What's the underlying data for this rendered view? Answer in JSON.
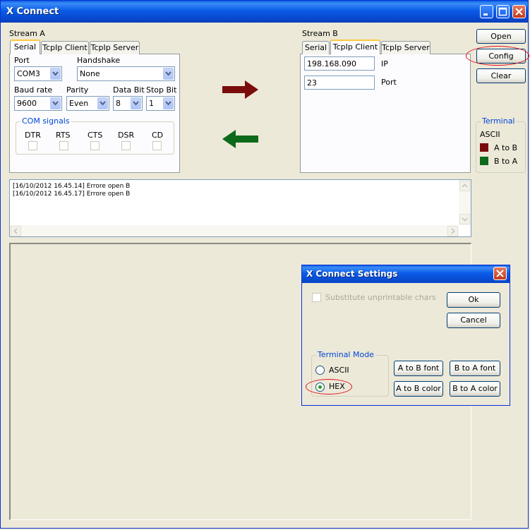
{
  "window": {
    "title": "X Connect"
  },
  "stream_a": {
    "label": "Stream A",
    "tabs": [
      "Serial",
      "TcpIp Client",
      "TcpIp Server"
    ],
    "port_label": "Port",
    "port_value": "COM3",
    "handshake_label": "Handshake",
    "handshake_value": "None",
    "baud_label": "Baud rate",
    "baud_value": "9600",
    "parity_label": "Parity",
    "parity_value": "Even",
    "databit_label": "Data Bit",
    "databit_value": "8",
    "stopbit_label": "Stop Bit",
    "stopbit_value": "1",
    "com_signals_label": "COM signals",
    "signals": [
      "DTR",
      "RTS",
      "CTS",
      "DSR",
      "CD"
    ]
  },
  "stream_b": {
    "label": "Stream B",
    "tabs": [
      "Serial",
      "TcpIp Client",
      "TcpIp Server"
    ],
    "ip_value": "198.168.090",
    "ip_label": "IP",
    "port_value": "23",
    "port_label": "Port"
  },
  "side_buttons": {
    "open": "Open",
    "config": "Config",
    "clear": "Clear"
  },
  "terminal": {
    "label": "Terminal",
    "mode": "ASCII",
    "a_to_b": "A to B",
    "b_to_a": "B to A"
  },
  "colors": {
    "a_to_b": "#7b0c0c",
    "b_to_a": "#0d6a1a",
    "arrow_red": "#7b0c0c",
    "arrow_green": "#0d6a1a"
  },
  "log_lines": [
    "[16/10/2012 16.45.14] Errore open B",
    "[16/10/2012 16.45.17] Errore open B"
  ],
  "dialog": {
    "title": "X Connect Settings",
    "substitute_label": "Substitute unprintable chars",
    "ok": "Ok",
    "cancel": "Cancel",
    "terminal_mode_label": "Terminal Mode",
    "ascii": "ASCII",
    "hex": "HEX",
    "a_to_b_font": "A to B font",
    "b_to_a_font": "B to A font",
    "a_to_b_color": "A to B color",
    "b_to_a_color": "B to A color"
  }
}
